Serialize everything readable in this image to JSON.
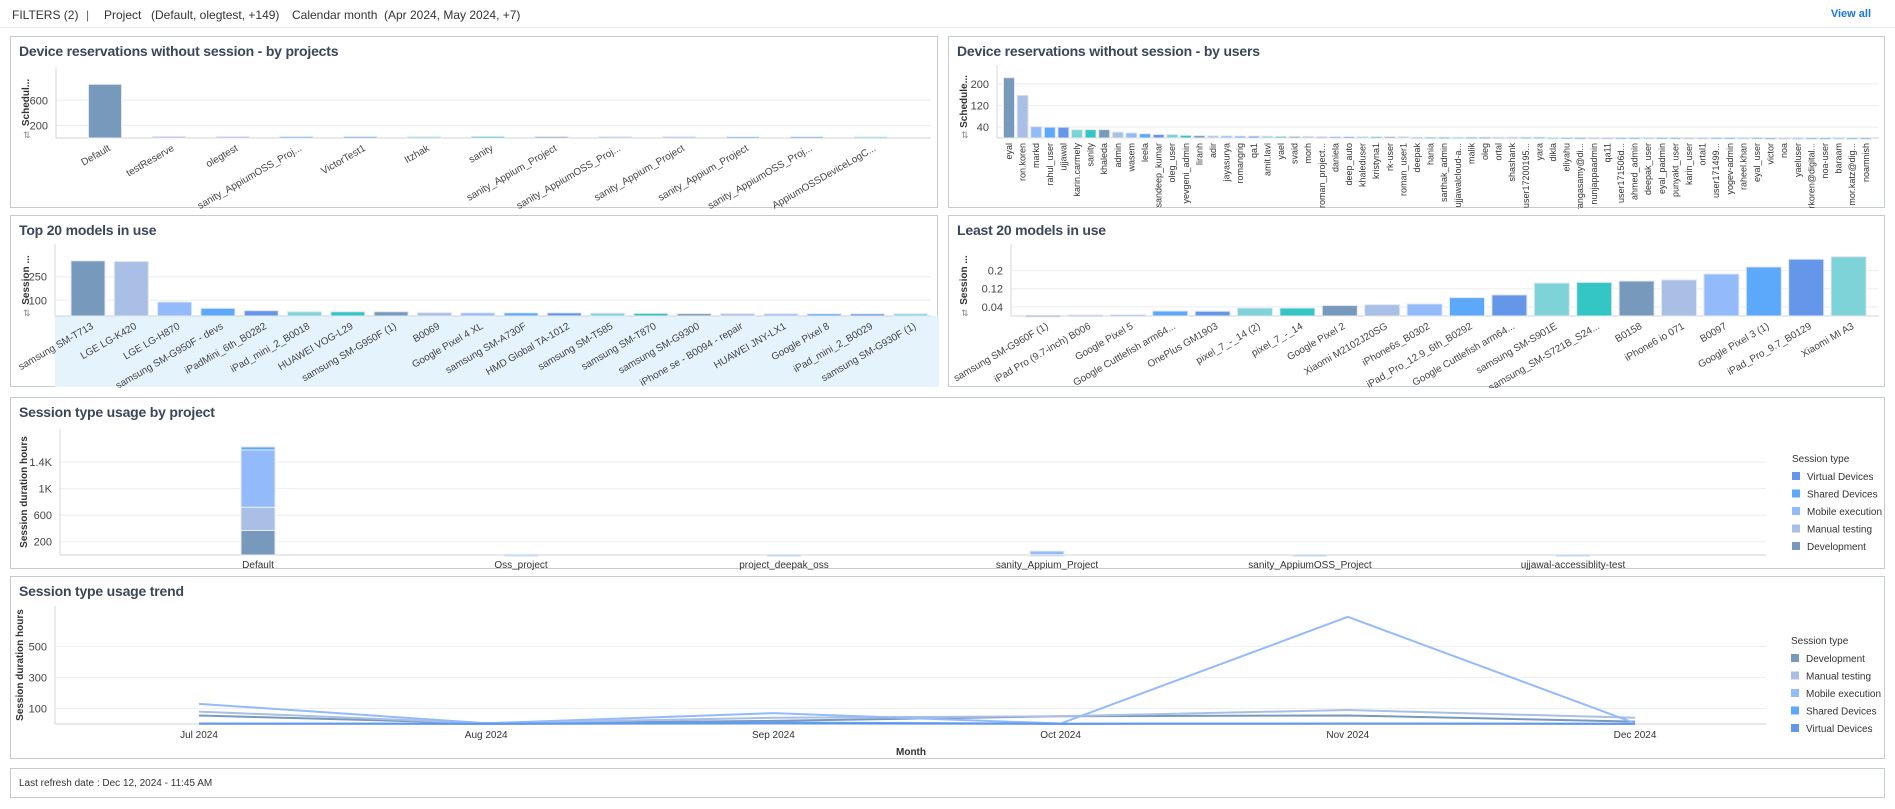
{
  "filters": {
    "label": "FILTERS (2)",
    "separator": "|",
    "items": [
      {
        "name": "Project",
        "value": "(Default, olegtest, +149)"
      },
      {
        "name": "Calendar month",
        "value": "(Apr 2024, May 2024, +7)"
      }
    ],
    "view_all": "View all"
  },
  "palette": [
    "#7799bb",
    "#aabfe6",
    "#93bbfc",
    "#5ca8fb",
    "#6497ea",
    "#7ed3d8",
    "#33c6c4"
  ],
  "footer": {
    "last_refresh": "Last refresh date : Dec 12, 2024 - 11:45 AM"
  },
  "chart_data": [
    {
      "type": "bar",
      "title": "Device reservations without session - by projects",
      "ylabel": "Schedul...",
      "ylim": [
        0,
        1130
      ],
      "yticks": [
        200,
        600
      ],
      "ytick_labels": [
        "200",
        "600"
      ],
      "grid": true,
      "categories": [
        "Default",
        "testReserve",
        "olegtest",
        "sanity_AppiumOSS_Proj...",
        "VictorTest1",
        "Itzhak",
        "sanity",
        "sanity_Appium_Project",
        "sanity_AppiumOSS_Proj...",
        "sanity_Appium_Project",
        "sanity_Appium_Project",
        "sanity_AppiumOSS_Proj...",
        "AppiumOSSDeviceLogC..."
      ],
      "values": [
        854,
        25,
        22,
        22,
        22,
        20,
        25,
        22,
        20,
        20,
        18,
        18,
        16
      ]
    },
    {
      "type": "bar",
      "title": "Device reservations without session - by users",
      "ylabel": "Schedule...",
      "ylim": [
        0,
        270
      ],
      "yticks": [
        40,
        120,
        200
      ],
      "ytick_labels": [
        "40",
        "120",
        "200"
      ],
      "grid": true,
      "categories": [
        "eyal",
        "ron.koren",
        "markd",
        "rahul_user",
        "ujjawal",
        "karin.carmely",
        "sanity",
        "khaleda",
        "admin",
        "wasem",
        "leela",
        "sandeep_kumar",
        "oleg_user",
        "yevgeni_admin",
        "liranh",
        "adir",
        "jayasurya",
        "romangrig",
        "qa1",
        "amit.lavi",
        "yael",
        "svaid",
        "morh",
        "roman_project...",
        "daniela",
        "deep_auto",
        "khaleduser",
        "kristyna1",
        "rk-user",
        "roman_user1",
        "deepak",
        "hania",
        "sarthak_admin",
        "ujjawalcloud-a...",
        "malik",
        "oleg",
        "ortal",
        "shashank",
        "user17200195...",
        "yara",
        "dikla",
        "eliyahu",
        "srangasamy@di...",
        "nunjappaadmin",
        "qa11",
        "user171506d...",
        "ahmed_admin",
        "deepak_user",
        "eyal_padmin",
        "punyakt_user",
        "karin_user",
        "ortal1",
        "user171499...",
        "yogev-admin",
        "raheel.khan",
        "eyal_user",
        "victor",
        "noa",
        "yaeluser",
        "rkoren@digital...",
        "noa-user",
        "baraam",
        "mor.katz@dig...",
        "noamnish"
      ],
      "values": [
        223,
        158,
        42,
        40,
        40,
        31,
        31,
        31,
        22,
        19,
        16,
        13,
        13,
        10,
        9,
        8,
        8,
        7,
        7,
        7,
        6,
        6,
        6,
        5,
        5,
        5,
        5,
        5,
        5,
        5,
        3,
        3,
        3,
        3,
        3,
        3,
        3,
        3,
        3,
        3,
        2,
        2,
        2,
        2,
        2,
        2,
        2,
        2,
        2,
        2,
        2,
        2,
        2,
        2,
        2,
        2,
        1,
        1,
        1,
        1,
        1,
        1,
        1,
        1
      ]
    },
    {
      "type": "bar",
      "title": "Top 20 models in use",
      "ylabel": "Session ...",
      "ylim": [
        0,
        458
      ],
      "yticks": [
        100,
        250
      ],
      "ytick_labels": [
        "100",
        "250"
      ],
      "grid": true,
      "categories": [
        "samsung SM-T713",
        "LGE LG-K420",
        "LGE LG-H870",
        "samsung SM-G950F - devs",
        "iPadMini_6th_B0282",
        "iPad_mini_2_B0018",
        "HUAWEI VOG-L29",
        "samsung SM-G950F (1)",
        "B0069",
        "Google Pixel 4 XL",
        "samsung SM-A730F",
        "HMD Global TA-1012",
        "samsung SM-T585",
        "samsung SM-T870",
        "samsung SM-G9300",
        "iPhone se - B0094 - repair",
        "HUAWEI JNY-LX1",
        "Google Pixel 8",
        "iPad_mini_2_B0029",
        "samsung SM-G930F (1)"
      ],
      "values": [
        351,
        347,
        89,
        49,
        34,
        27,
        27,
        27,
        21,
        20,
        20,
        20,
        18,
        17,
        15,
        15,
        14,
        14,
        14,
        14
      ]
    },
    {
      "type": "bar",
      "title": "Least 20 models in use",
      "ylabel": "Session ...",
      "ylim": [
        0,
        0.317
      ],
      "yticks": [
        0.04,
        0.12,
        0.2
      ],
      "ytick_labels": [
        "0.04",
        "0.12",
        "0.2"
      ],
      "grid": true,
      "categories": [
        "samsung SM-G960F (1)",
        "iPad Pro (9.7-inch) B006",
        "Google Pixel 5",
        "Google Cuttlefish arm64...",
        "OnePlus GM1903",
        "pixel_7_-_14 (2)",
        "pixel_7_-_14",
        "Google Pixel 2",
        "Xiaomi M2102J20SG",
        "iPhone6s_B0302",
        "iPad_Pro_12.9_6th_B0292",
        "Google Cuttlefish arm64...",
        "samsung SM-S901E",
        "samsung_SM-S721B_S24...",
        "B0158",
        "iPhone6 io 071",
        "B0097",
        "Google Pixel 3 (1)",
        "iPad_Pro_9.7_B0129",
        "Xiaomi MI A3"
      ],
      "values": [
        0.003,
        0.004,
        0.005,
        0.022,
        0.021,
        0.035,
        0.035,
        0.046,
        0.05,
        0.053,
        0.081,
        0.093,
        0.145,
        0.148,
        0.154,
        0.159,
        0.185,
        0.216,
        0.25,
        0.261
      ]
    },
    {
      "type": "bar",
      "stacked": true,
      "title": "Session type usage by project",
      "ylabel": "Session duration hours",
      "ylim": [
        0,
        1900
      ],
      "yticks": [
        200,
        600,
        1000,
        1400
      ],
      "ytick_labels": [
        "200",
        "600",
        "1K",
        "1.4K"
      ],
      "grid": true,
      "legend_title": "Session type",
      "legend_position": "right",
      "legend_order": [
        "Virtual Devices",
        "Shared Devices",
        "Mobile execution",
        "Manual testing",
        "Development"
      ],
      "categories": [
        "Default",
        "Oss_project",
        "project_deepak_oss",
        "sanity_Appium_Project",
        "sanity_AppiumOSS_Project",
        "ujjawal-accessiblity-test"
      ],
      "series": [
        {
          "name": "Development",
          "color": "#7799bb",
          "values": [
            370,
            3,
            2,
            0,
            2,
            2
          ]
        },
        {
          "name": "Manual testing",
          "color": "#aabfe6",
          "values": [
            350,
            2,
            2,
            5,
            2,
            2
          ]
        },
        {
          "name": "Mobile execution",
          "color": "#93bbfc",
          "values": [
            865,
            5,
            4,
            55,
            4,
            4
          ]
        },
        {
          "name": "Shared Devices",
          "color": "#5ca8fb",
          "values": [
            45,
            0,
            0,
            0,
            0,
            0
          ]
        },
        {
          "name": "Virtual Devices",
          "color": "#6497ea",
          "values": [
            0,
            0,
            0,
            0,
            0,
            0
          ]
        }
      ]
    },
    {
      "type": "line",
      "title": "Session type usage trend",
      "xlabel": "Month",
      "ylabel": "Session duration hours",
      "ylim": [
        0,
        760
      ],
      "yticks": [
        100,
        300,
        500
      ],
      "ytick_labels": [
        "100",
        "300",
        "500"
      ],
      "grid": true,
      "legend_title": "Session type",
      "legend_position": "right",
      "legend_order": [
        "Development",
        "Manual testing",
        "Mobile execution",
        "Shared Devices",
        "Virtual Devices"
      ],
      "x": [
        "Jul 2024",
        "Aug 2024",
        "Sep 2024",
        "Oct 2024",
        "Nov 2024",
        "Dec 2024"
      ],
      "series": [
        {
          "name": "Development",
          "color": "#7799bb",
          "values": [
            55,
            5,
            20,
            50,
            55,
            15
          ]
        },
        {
          "name": "Manual testing",
          "color": "#aabfe6",
          "values": [
            80,
            5,
            40,
            50,
            90,
            40
          ]
        },
        {
          "name": "Mobile execution",
          "color": "#93bbfc",
          "values": [
            130,
            5,
            70,
            3,
            690,
            5
          ]
        },
        {
          "name": "Shared Devices",
          "color": "#5ca8fb",
          "values": [
            3,
            2,
            10,
            2,
            3,
            2
          ]
        },
        {
          "name": "Virtual Devices",
          "color": "#6497ea",
          "values": [
            2,
            1,
            3,
            1,
            2,
            1
          ]
        }
      ]
    }
  ]
}
